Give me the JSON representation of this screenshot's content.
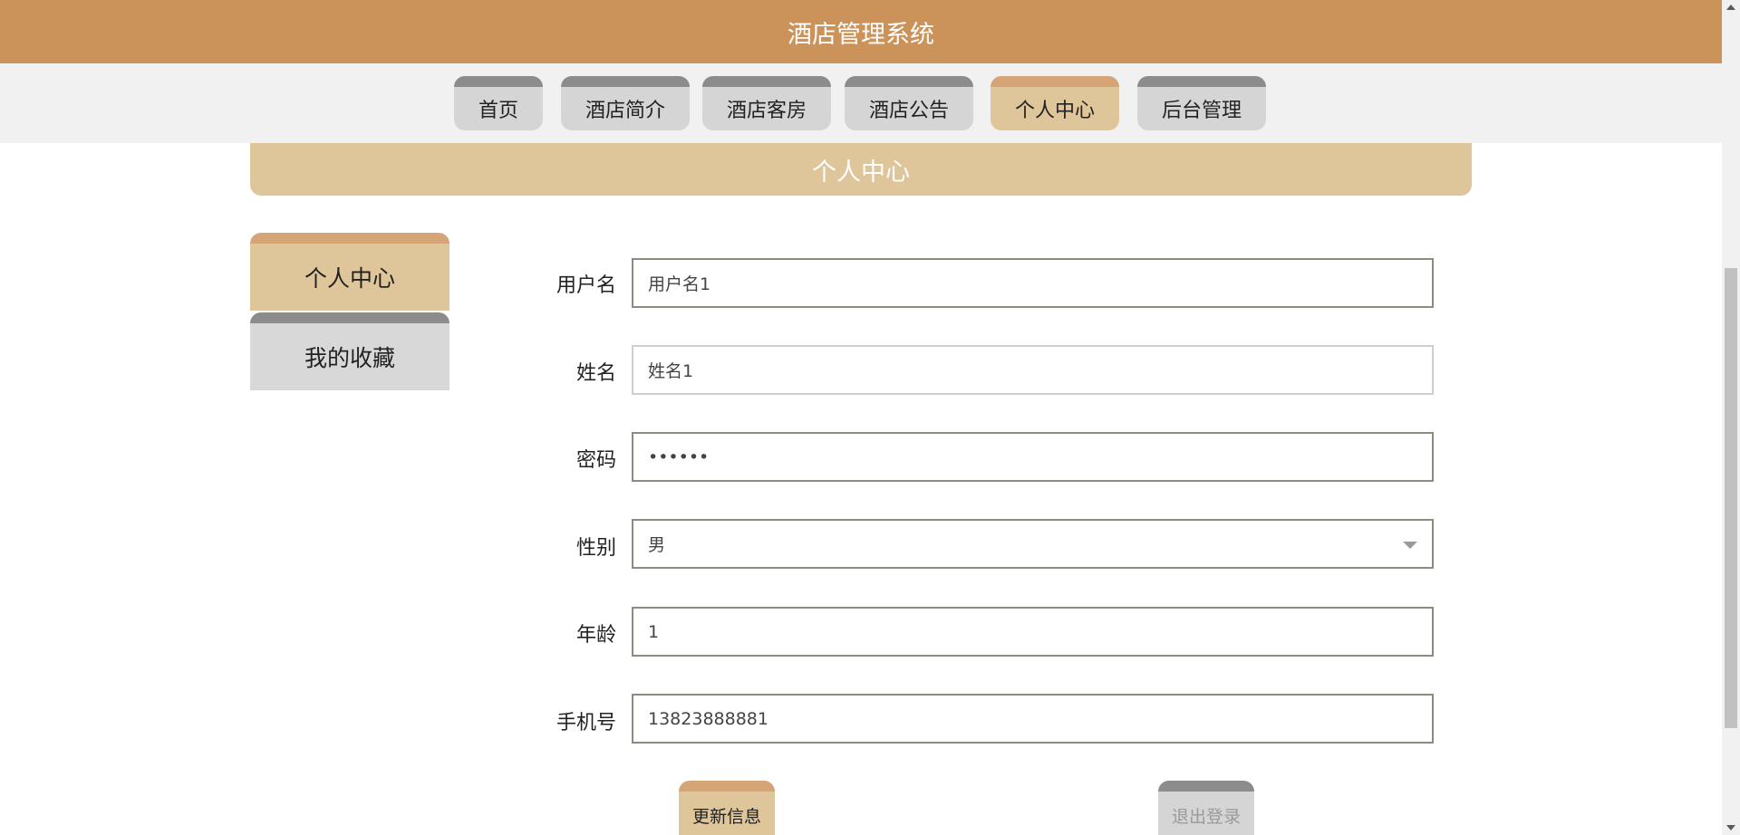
{
  "header": {
    "title": "酒店管理系统"
  },
  "nav": {
    "tabs": [
      {
        "label": "首页",
        "active": false
      },
      {
        "label": "酒店简介",
        "active": false
      },
      {
        "label": "酒店客房",
        "active": false
      },
      {
        "label": "酒店公告",
        "active": false
      },
      {
        "label": "个人中心",
        "active": true
      },
      {
        "label": "后台管理",
        "active": false
      }
    ]
  },
  "banner": {
    "title": "个人中心"
  },
  "sidebar": {
    "items": [
      {
        "label": "个人中心",
        "active": true
      },
      {
        "label": "我的收藏",
        "active": false
      }
    ]
  },
  "form": {
    "username": {
      "label": "用户名",
      "value": "用户名1"
    },
    "name": {
      "label": "姓名",
      "value": "姓名1"
    },
    "password": {
      "label": "密码",
      "value": "••••••"
    },
    "gender": {
      "label": "性别",
      "value": "男"
    },
    "age": {
      "label": "年龄",
      "value": "1"
    },
    "phone": {
      "label": "手机号",
      "value": "13823888881"
    }
  },
  "actions": {
    "update_label": "更新信息",
    "logout_label": "退出登录"
  },
  "colors": {
    "brand": "#cb9259",
    "accent_light": "#dfc59a",
    "accent_top": "#d6a577",
    "inactive_tab": "#d5d5d5",
    "inactive_top": "#8c8c8c"
  }
}
